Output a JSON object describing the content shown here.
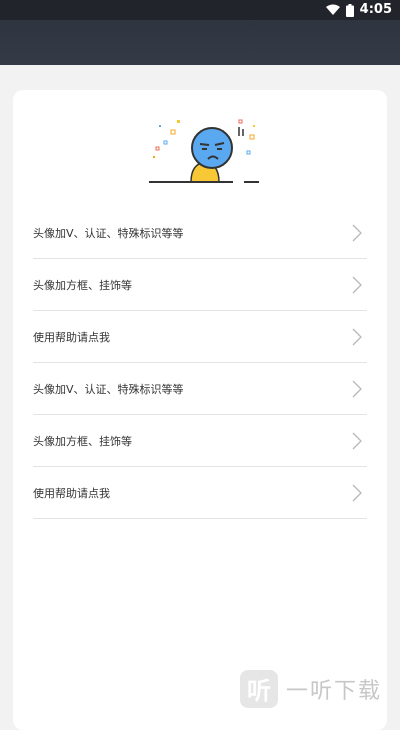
{
  "status_bar": {
    "time": "4:05",
    "icons": [
      "wifi-icon",
      "battery-icon"
    ]
  },
  "list": {
    "items": [
      {
        "label": "头像加V、认证、特殊标识等等"
      },
      {
        "label": "头像加方框、挂饰等"
      },
      {
        "label": "使用帮助请点我"
      },
      {
        "label": "头像加V、认证、特殊标识等等"
      },
      {
        "label": "头像加方框、挂饰等"
      },
      {
        "label": "使用帮助请点我"
      }
    ]
  },
  "watermark": {
    "logo_text": "听",
    "text": "一听下载"
  },
  "colors": {
    "status_bar": "#21252b",
    "app_bar": "#353b46",
    "background": "#f2f2f3",
    "face_blue": "#5aa9f0",
    "body_yellow": "#f7c736"
  }
}
